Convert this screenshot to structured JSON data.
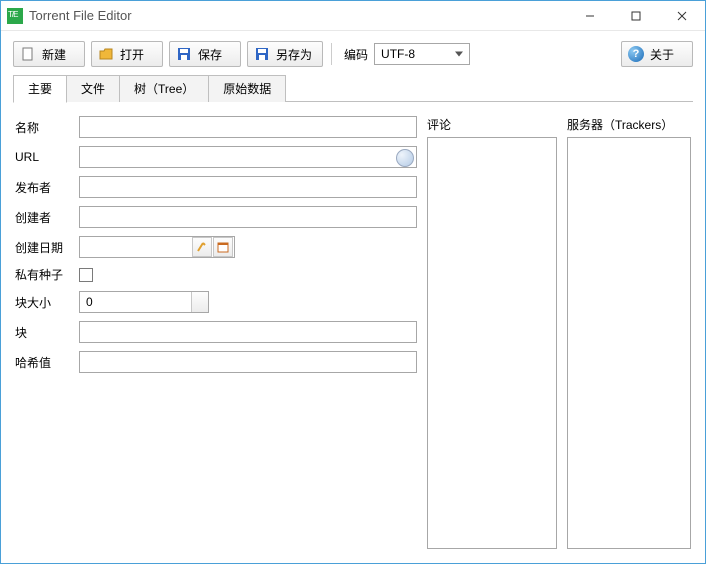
{
  "window": {
    "title": "Torrent File Editor"
  },
  "toolbar": {
    "new": "新建",
    "open": "打开",
    "save": "保存",
    "saveas": "另存为",
    "encoding_label": "编码",
    "encoding_value": "UTF-8",
    "about": "关于"
  },
  "tabs": {
    "main": "主要",
    "files": "文件",
    "tree": "树（Tree）",
    "raw": "原始数据"
  },
  "form": {
    "name_label": "名称",
    "url_label": "URL",
    "publisher_label": "发布者",
    "creator_label": "创建者",
    "created_label": "创建日期",
    "private_label": "私有种子",
    "piece_size_label": "块大小",
    "piece_size_value": "0",
    "pieces_label": "块",
    "hash_label": "哈希值"
  },
  "side": {
    "comments_label": "评论",
    "trackers_label": "服务器（Trackers）"
  }
}
